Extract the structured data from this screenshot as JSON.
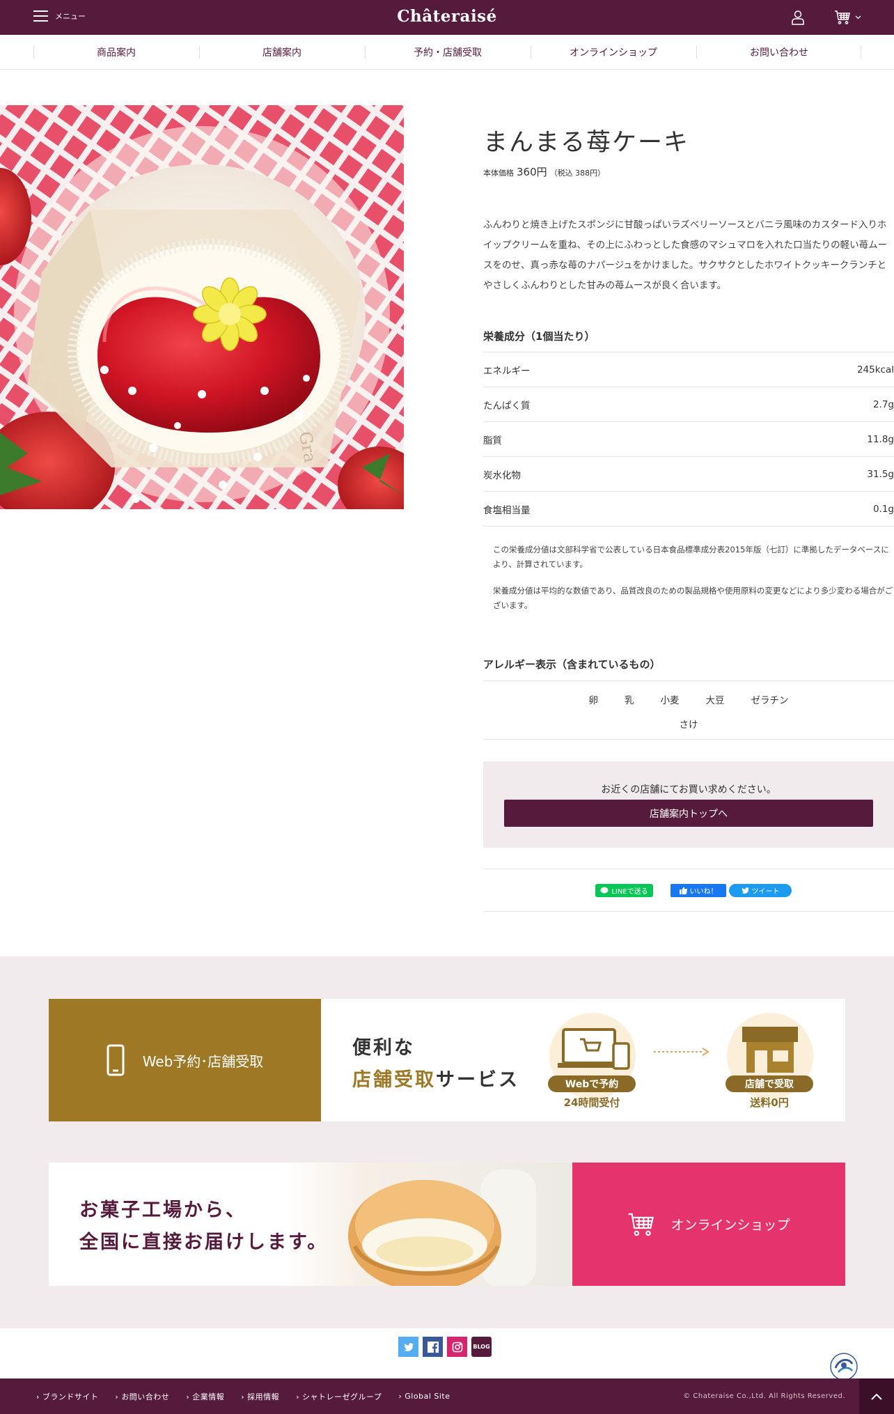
{
  "header": {
    "menu_label": "メニュー",
    "logo": "Châteraisé"
  },
  "nav": [
    "商品案内",
    "店舗案内",
    "予約・店舗受取",
    "オンラインショップ",
    "お問い合わせ"
  ],
  "product": {
    "title": "まんまる苺ケーキ",
    "price_prefix": "本体価格",
    "price": "360円",
    "price_tax": "（税込 388円）",
    "description": "ふんわりと焼き上げたスポンジに甘酸っぱいラズベリーソースとバニラ風味のカスタード入りホイップクリームを重ね、その上にふわっとした食感のマシュマロを入れた口当たりの軽い苺ムースをのせ、真っ赤な苺のナパージュをかけました。サクサクとしたホワイトクッキークランチとやさしくふんわりとした甘みの苺ムースが良く合います。",
    "image_text": "Gra"
  },
  "nutrition": {
    "heading": "栄養成分（1個当たり）",
    "rows": [
      {
        "name": "エネルギー",
        "value": "245kcal"
      },
      {
        "name": "たんぱく質",
        "value": "2.7g"
      },
      {
        "name": "脂質",
        "value": "11.8g"
      },
      {
        "name": "炭水化物",
        "value": "31.5g"
      },
      {
        "name": "食塩相当量",
        "value": "0.1g"
      }
    ],
    "note1": "この栄養成分値は文部科学省で公表している日本食品標準成分表2015年版（七訂）に準拠したデータベースにより、計算されています。",
    "note2": "栄養成分値は平均的な数値であり、品質改良のための製品規格や使用原料の変更などにより多少変わる場合がございます。"
  },
  "allergy": {
    "heading": "アレルギー表示（含まれているもの）",
    "row1": [
      "卵",
      "乳",
      "小麦",
      "大豆",
      "ゼラチン"
    ],
    "row2": "さけ"
  },
  "store": {
    "message": "お近くの店舗にてお買い求めください。",
    "button": "店舗案内トップへ"
  },
  "share": {
    "line": "LINEで送る",
    "like": "いいね！",
    "tweet": "ツイート"
  },
  "banner_web": {
    "left_label": "Web予約･店舗受取",
    "line1": "便利な",
    "line2a": "店舗受取",
    "line2b": "サービス",
    "badge1": "Webで予約",
    "sub1": "24時間受付",
    "badge2": "店舗で受取",
    "sub2": "送料0円"
  },
  "banner_online": {
    "line1": "お菓子工場から、",
    "line2": "全国に直接お届けします。",
    "label": "オンラインショップ"
  },
  "social": {
    "blog": "BLOG"
  },
  "footer": {
    "links": [
      "ブランドサイト",
      "お問い合わせ",
      "企業情報",
      "採用情報",
      "シャトレーゼグループ",
      "Global Site"
    ],
    "copyright": "© Chateraise Co.,Ltd. All Rights Reserved."
  },
  "colors": {
    "brand": "#561a3c",
    "gold": "#9e7825",
    "pink": "#e5336e",
    "bg_tint": "#f1ebee"
  }
}
